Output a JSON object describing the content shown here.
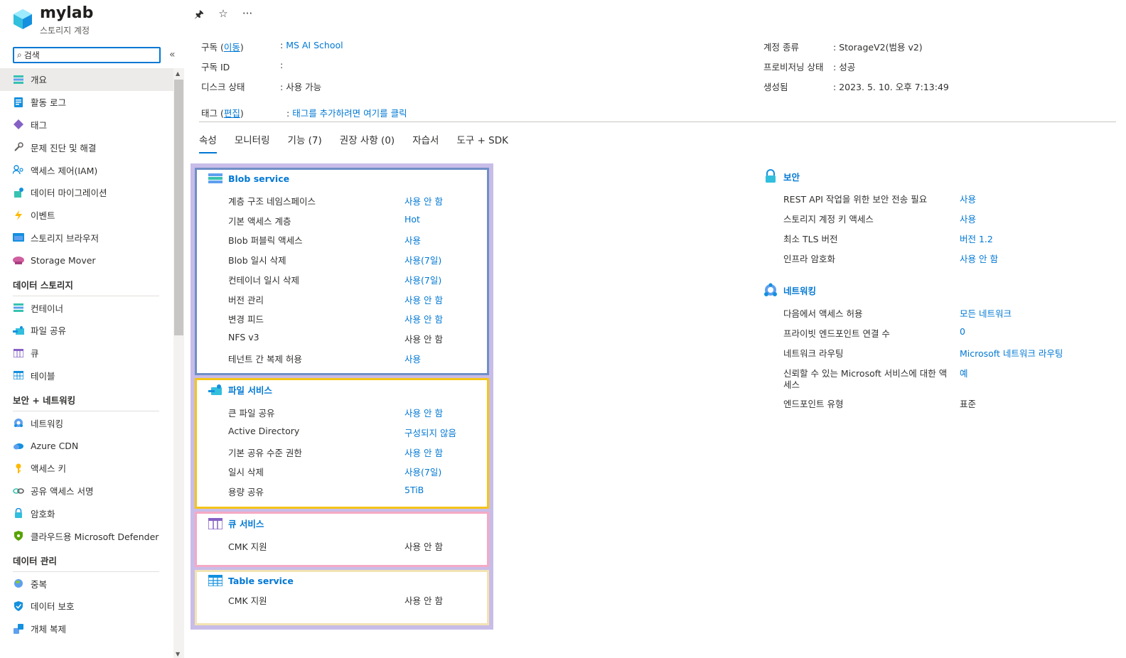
{
  "header": {
    "title": "mylab",
    "subtitle": "스토리지 계정",
    "icon": "storage-account-icon"
  },
  "search": {
    "value": "검색",
    "placeholder": "검색"
  },
  "nav": {
    "items_top": [
      {
        "label": "개요",
        "icon": "overview-icon",
        "active": true
      },
      {
        "label": "활동 로그",
        "icon": "activity-log-icon"
      },
      {
        "label": "태그",
        "icon": "tag-icon"
      },
      {
        "label": "문제 진단 및 해결",
        "icon": "wrench-icon"
      },
      {
        "label": "액세스 제어(IAM)",
        "icon": "iam-icon"
      },
      {
        "label": "데이터 마이그레이션",
        "icon": "migration-icon"
      },
      {
        "label": "이벤트",
        "icon": "lightning-icon"
      },
      {
        "label": "스토리지 브라우저",
        "icon": "storage-browser-icon"
      },
      {
        "label": "Storage Mover",
        "icon": "storage-mover-icon"
      }
    ],
    "section_storage": "데이터 스토리지",
    "items_storage": [
      {
        "label": "컨테이너",
        "icon": "container-icon"
      },
      {
        "label": "파일 공유",
        "icon": "file-share-icon"
      },
      {
        "label": "큐",
        "icon": "queue-icon"
      },
      {
        "label": "테이블",
        "icon": "table-icon"
      }
    ],
    "section_security": "보안 + 네트워킹",
    "items_security": [
      {
        "label": "네트워킹",
        "icon": "networking-icon"
      },
      {
        "label": "Azure CDN",
        "icon": "cloud-icon"
      },
      {
        "label": "액세스 키",
        "icon": "key-icon"
      },
      {
        "label": "공유 액세스 서명",
        "icon": "link-icon"
      },
      {
        "label": "암호화",
        "icon": "lock-icon"
      },
      {
        "label": "클라우드용 Microsoft Defender",
        "icon": "defender-icon"
      }
    ],
    "section_data": "데이터 관리",
    "items_data": [
      {
        "label": "중복",
        "icon": "globe-icon"
      },
      {
        "label": "데이터 보호",
        "icon": "shield-icon"
      },
      {
        "label": "개체 복제",
        "icon": "replication-icon"
      }
    ]
  },
  "essentials": {
    "subscription_label": "구독",
    "subscription_move": "이동",
    "subscription_value": "MS AI School",
    "subscription_id_label": "구독 ID",
    "subscription_id_value": "",
    "disk_label": "디스크 상태",
    "disk_value": "사용 가능",
    "account_kind_label": "계정 종류",
    "account_kind_value": "StorageV2(범용 v2)",
    "provisioning_label": "프로비저닝 상태",
    "provisioning_value": "성공",
    "created_label": "생성됨",
    "created_value": "2023. 5. 10. 오후 7:13:49",
    "tags_label": "태그",
    "tags_edit": "편집",
    "tags_value": "태그를 추가하려면 여기를 클릭"
  },
  "tabs": [
    "속성",
    "모니터링",
    "기능 (7)",
    "권장 사항 (0)",
    "자습서",
    "도구 + SDK"
  ],
  "blob": {
    "title": "Blob service",
    "rows": [
      {
        "label": "계층 구조 네임스페이스",
        "value": "사용 안 함",
        "link": true
      },
      {
        "label": "기본 액세스 계층",
        "value": "Hot",
        "link": true
      },
      {
        "label": "Blob 퍼블릭 액세스",
        "value": "사용",
        "link": true
      },
      {
        "label": "Blob 일시 삭제",
        "value": "사용(7일)",
        "link": true
      },
      {
        "label": "컨테이너 일시 삭제",
        "value": "사용(7일)",
        "link": true
      },
      {
        "label": "버전 관리",
        "value": "사용 안 함",
        "link": true
      },
      {
        "label": "변경 피드",
        "value": "사용 안 함",
        "link": true
      },
      {
        "label": "NFS v3",
        "value": "사용 안 함",
        "link": false
      },
      {
        "label": "테넌트 간 복제 허용",
        "value": "사용",
        "link": true
      }
    ]
  },
  "file": {
    "title": "파일 서비스",
    "rows": [
      {
        "label": "큰 파일 공유",
        "value": "사용 안 함",
        "link": true
      },
      {
        "label": "Active Directory",
        "value": "구성되지 않음",
        "link": true
      },
      {
        "label": "기본 공유 수준 권한",
        "value": "사용 안 함",
        "link": true
      },
      {
        "label": "일시 삭제",
        "value": "사용(7일)",
        "link": true
      },
      {
        "label": "용량 공유",
        "value": "5TiB",
        "link": true
      }
    ]
  },
  "queue": {
    "title": "큐 서비스",
    "rows": [
      {
        "label": "CMK 지원",
        "value": "사용 안 함",
        "link": false
      }
    ]
  },
  "table": {
    "title": "Table service",
    "rows": [
      {
        "label": "CMK 지원",
        "value": "사용 안 함",
        "link": false
      }
    ]
  },
  "security": {
    "title": "보안",
    "rows": [
      {
        "label": "REST API 작업을 위한 보안 전송 필요",
        "value": "사용",
        "link": true
      },
      {
        "label": "스토리지 계정 키 액세스",
        "value": "사용",
        "link": true
      },
      {
        "label": "최소 TLS 버전",
        "value": "버전 1.2",
        "link": true
      },
      {
        "label": "인프라 암호화",
        "value": "사용 안 함",
        "link": true
      }
    ]
  },
  "networking": {
    "title": "네트워킹",
    "rows": [
      {
        "label": "다음에서 액세스 허용",
        "value": "모든 네트워크",
        "link": true
      },
      {
        "label": "프라이빗 엔드포인트 연결 수",
        "value": "0",
        "link": true
      },
      {
        "label": "네트워크 라우팅",
        "value": "Microsoft 네트워크 라우팅",
        "link": true
      },
      {
        "label": "신뢰할 수 있는 Microsoft 서비스에 대한 액",
        "label2": "세스",
        "value": "예",
        "link": true
      },
      {
        "label": "엔드포인트 유형",
        "value": "표준",
        "link": false
      }
    ]
  },
  "colors": {
    "accent": "#0078d4",
    "blob_border": "#6f8fc6",
    "file_border": "#f5c518",
    "queue_border": "#f5a9c4",
    "table_border": "#f3e3b2",
    "outer_frame": "#c8bce8"
  }
}
